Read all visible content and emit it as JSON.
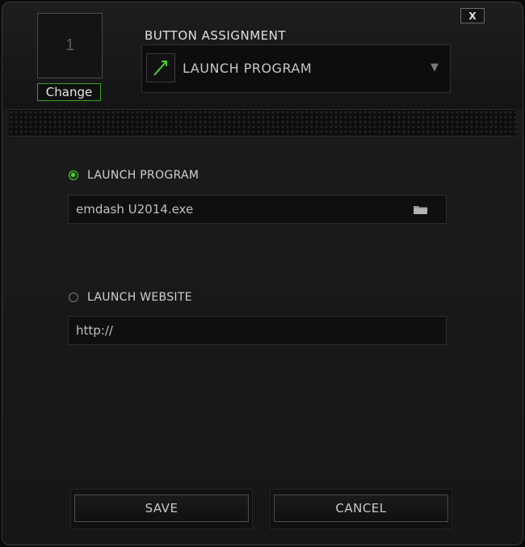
{
  "header": {
    "key_number": "1",
    "change_label": "Change",
    "close_label": "X",
    "assignment_title": "BUTTON ASSIGNMENT",
    "assignment_value": "LAUNCH PROGRAM"
  },
  "options": {
    "program": {
      "label": "LAUNCH PROGRAM",
      "selected": true,
      "value": "emdash U2014.exe",
      "browse_icon": "folder-icon"
    },
    "website": {
      "label": "LAUNCH WEBSITE",
      "selected": false,
      "value": "http://"
    }
  },
  "footer": {
    "save_label": "SAVE",
    "cancel_label": "CANCEL"
  },
  "colors": {
    "accent": "#44d62c",
    "background": "#161616"
  }
}
